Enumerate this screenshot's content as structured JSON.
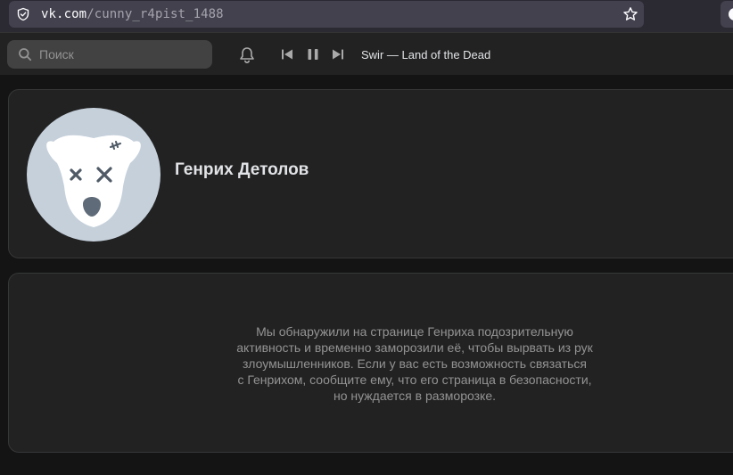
{
  "browser": {
    "url_host": "vk.com",
    "url_path": "/cunny_r4pist_1488"
  },
  "header": {
    "search_placeholder": "Поиск",
    "player": {
      "track": "Swir — Land of the Dead"
    }
  },
  "profile": {
    "name": "Генрих Детолов"
  },
  "notice": {
    "lines": [
      "Мы обнаружили на странице Генриха подозрительную",
      "активность и временно заморозили её, чтобы вырвать из рук",
      "злоумышленников. Если у вас есть возможность связаться",
      "с Генрихом, сообщите ему, что его страница в безопасности,",
      "но нуждается в разморозке."
    ]
  },
  "colors": {
    "background": "#141414",
    "card": "#222222",
    "avatar_bg": "#c5d0db",
    "text_primary": "#e1e3e6",
    "text_secondary": "#939393"
  }
}
